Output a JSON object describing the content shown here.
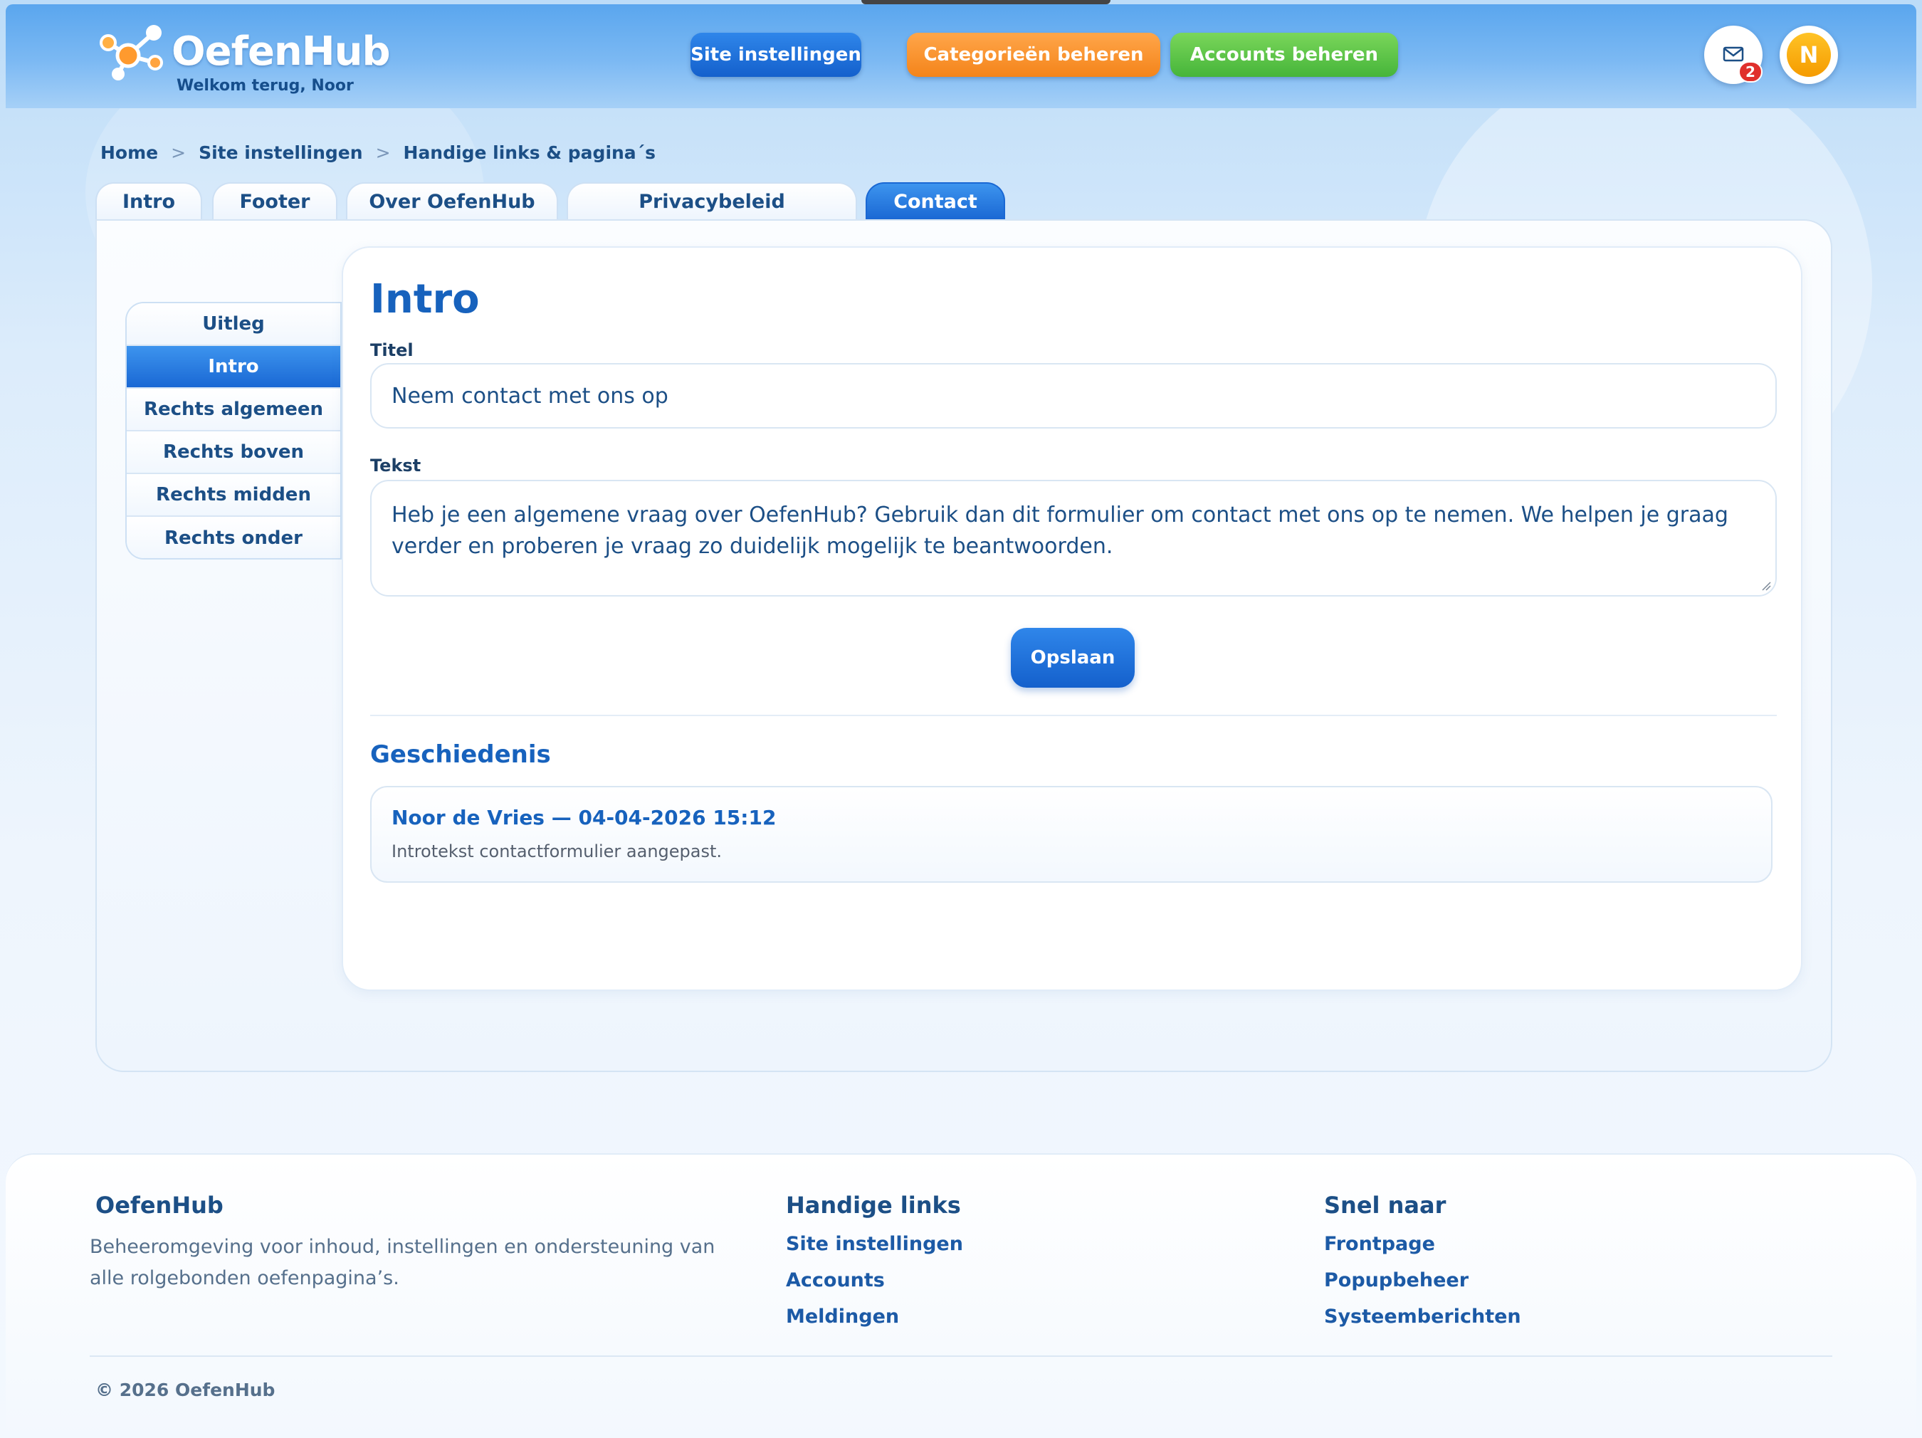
{
  "header": {
    "brand": "OefenHub",
    "welcome": "Welkom terug, Noor",
    "buttons": {
      "site_settings": "Site instellingen",
      "categories": "Categorieën beheren",
      "accounts": "Accounts beheren"
    },
    "mail_badge": "2",
    "avatar_initial": "N"
  },
  "breadcrumb": [
    "Home",
    "Site instellingen",
    "Handige links & pagina´s"
  ],
  "tabs": [
    "Intro",
    "Footer",
    "Over OefenHub",
    "Privacybeleid",
    "Contact"
  ],
  "active_tab": "Contact",
  "side_menu": [
    "Uitleg",
    "Intro",
    "Rechts algemeen",
    "Rechts boven",
    "Rechts midden",
    "Rechts onder"
  ],
  "active_side_item": "Intro",
  "form": {
    "heading": "Intro",
    "title_label": "Titel",
    "title_value": "Neem contact met ons op",
    "text_label": "Tekst",
    "text_value": "Heb je een algemene vraag over OefenHub? Gebruik dan dit formulier om contact met ons op te nemen. We helpen je graag verder en proberen je vraag zo duidelijk mogelijk te beantwoorden.",
    "save_label": "Opslaan"
  },
  "history": {
    "heading": "Geschiedenis",
    "items": [
      {
        "author_date": "Noor de Vries — 04-04-2026 15:12",
        "note": "Introtekst contactformulier aangepast."
      }
    ]
  },
  "footer": {
    "col1_title": "OefenHub",
    "col1_text": "Beheeromgeving voor inhoud, instellingen en ondersteuning van alle rolgebonden oefenpagina’s.",
    "col2_title": "Handige links",
    "col2_links": [
      "Site instellingen",
      "Accounts",
      "Meldingen"
    ],
    "col3_title": "Snel naar",
    "col3_links": [
      "Frontpage",
      "Popupbeheer",
      "Systeemberichten"
    ],
    "copyright": "© 2026 OefenHub"
  },
  "colors": {
    "primary": "#1a68d4",
    "orange": "#f4841a",
    "green": "#46b53a",
    "badge": "#e0302c"
  },
  "icons": [
    "logo-molecule-icon",
    "mail-icon",
    "resize-grip-icon"
  ]
}
